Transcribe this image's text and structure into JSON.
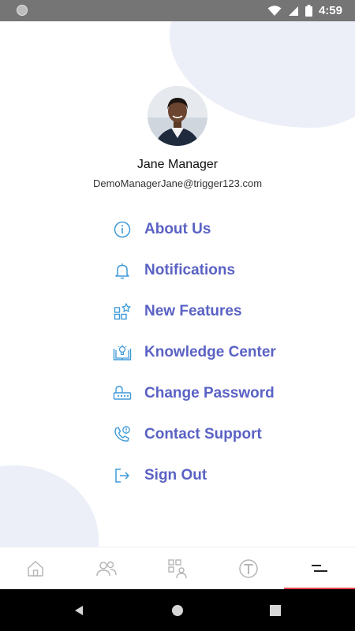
{
  "status_bar": {
    "time": "4:59"
  },
  "profile": {
    "name": "Jane Manager",
    "email": "DemoManagerJane@trigger123.com"
  },
  "menu": [
    {
      "label": "About Us",
      "icon": "info-icon"
    },
    {
      "label": "Notifications",
      "icon": "bell-icon"
    },
    {
      "label": "New Features",
      "icon": "new-features-icon"
    },
    {
      "label": "Knowledge Center",
      "icon": "knowledge-book-icon"
    },
    {
      "label": "Change Password",
      "icon": "password-key-icon"
    },
    {
      "label": "Contact Support",
      "icon": "phone-support-icon"
    },
    {
      "label": "Sign Out",
      "icon": "sign-out-icon"
    }
  ],
  "tabs": [
    {
      "name": "home",
      "icon": "home-icon"
    },
    {
      "name": "people",
      "icon": "people-icon"
    },
    {
      "name": "qr-user",
      "icon": "qr-user-icon"
    },
    {
      "name": "trigger",
      "icon": "trigger-t-icon"
    },
    {
      "name": "menu",
      "icon": "menu-icon",
      "active": true
    }
  ],
  "colors": {
    "accent": "#5a62c4",
    "icon_blue": "#3f9ad8",
    "tab_active_indicator": "#e5474f",
    "blob": "#eceff7"
  }
}
